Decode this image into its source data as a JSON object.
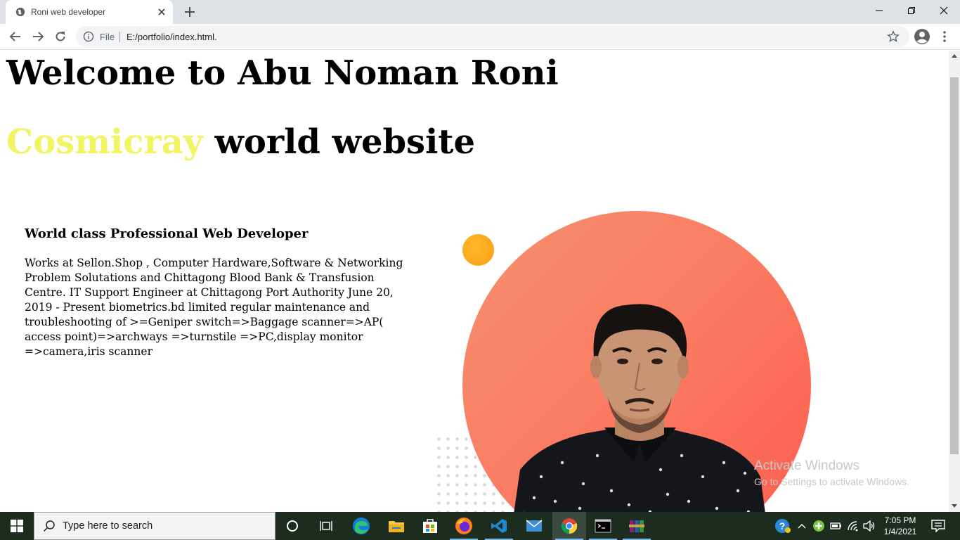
{
  "browser": {
    "tab_title": "Roni web developer",
    "omnibox_scheme": "File",
    "url": "E:/portfolio/index.html."
  },
  "page": {
    "heading_line1": "Welcome to Abu Noman Roni",
    "heading_accent": "Cosmicray",
    "heading_rest": " world website",
    "subheading": "World class Professional Web Developer",
    "paragraph": "Works at Sellon.Shop , Computer Hardware,Software & Networking Problem Solutations and Chittagong Blood Bank & Transfusion Centre. IT Support Engineer at Chittagong Port Authority June 20, 2019 - Present biometrics.bd limited regular maintenance and troubleshooting of >=Geniper switch=>Baggage scanner=>AP( access point)=>archways =>turnstile =>PC,display monitor =>camera,iris scanner"
  },
  "watermark": {
    "title": "Activate Windows",
    "subtitle": "Go to Settings to activate Windows."
  },
  "taskbar": {
    "search_placeholder": "Type here to search",
    "time": "7:05 PM",
    "date": "1/4/2021"
  },
  "colors": {
    "accent_text": "#f1f564",
    "circle": "#fa7d63",
    "orange_dot": "#fb9d16",
    "taskbar": "#1c2d20"
  }
}
